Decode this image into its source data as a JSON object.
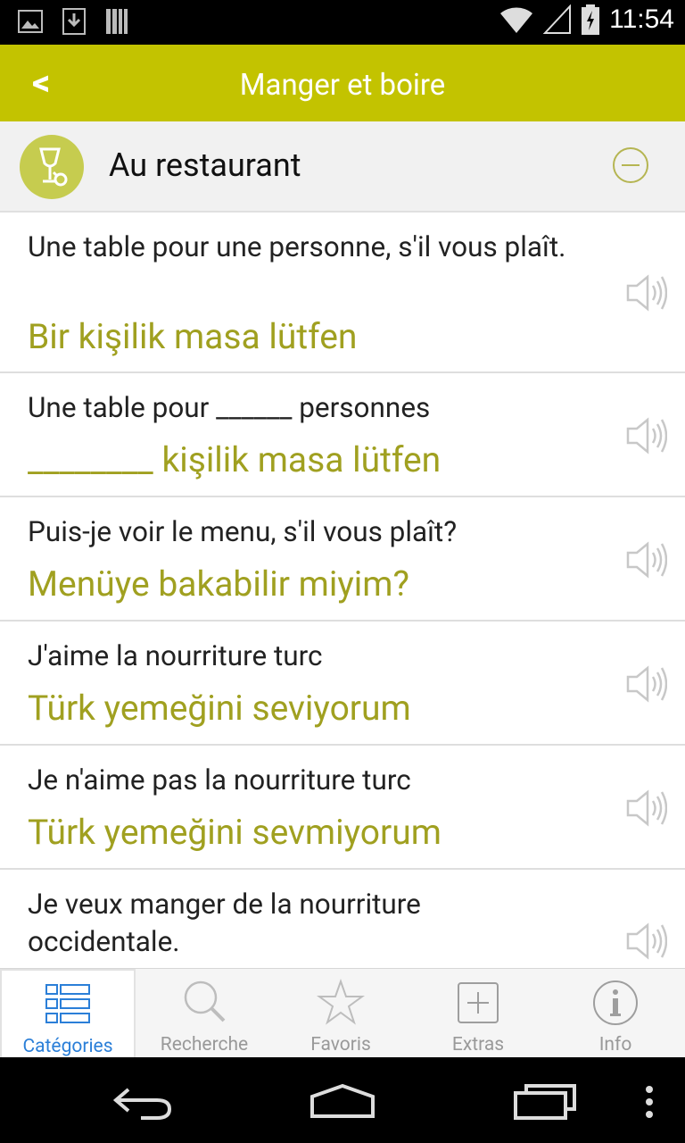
{
  "status_bar": {
    "time": "11:54"
  },
  "header": {
    "back_label": "<",
    "title": "Manger et boire"
  },
  "section": {
    "title": "Au restaurant"
  },
  "phrases": [
    {
      "french": "Une table pour une personne, s'il vous plaît.",
      "turkish": "Bir kişilik masa lütfen"
    },
    {
      "french": "Une table pour ______ personnes",
      "turkish": "________ kişilik masa lütfen"
    },
    {
      "french": "Puis-je voir le menu, s'il vous plaît?",
      "turkish": "Menüye bakabilir miyim?"
    },
    {
      "french": "J'aime la nourriture turc",
      "turkish": "Türk yemeğini seviyorum"
    },
    {
      "french": "Je n'aime pas la nourriture turc",
      "turkish": "Türk yemeğini sevmiyorum"
    },
    {
      "french": "Je veux manger de la nourriture occidentale.",
      "turkish": ""
    }
  ],
  "tabs": [
    {
      "label": "Catégories",
      "icon": "categories-icon",
      "active": true
    },
    {
      "label": "Recherche",
      "icon": "search-icon",
      "active": false
    },
    {
      "label": "Favoris",
      "icon": "star-icon",
      "active": false
    },
    {
      "label": "Extras",
      "icon": "plus-box-icon",
      "active": false
    },
    {
      "label": "Info",
      "icon": "info-icon",
      "active": false
    }
  ],
  "colors": {
    "accent": "#c3c300",
    "translation": "#a0a020",
    "active_tab": "#2b7fd8"
  }
}
